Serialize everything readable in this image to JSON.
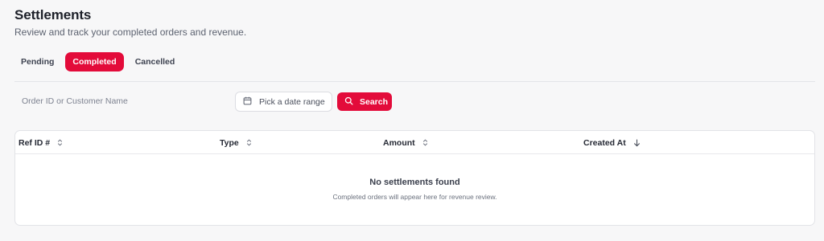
{
  "header": {
    "title": "Settlements",
    "subtitle": "Review and track your completed orders and revenue."
  },
  "tabs": [
    {
      "label": "Pending",
      "active": false
    },
    {
      "label": "Completed",
      "active": true
    },
    {
      "label": "Cancelled",
      "active": false
    }
  ],
  "filters": {
    "search_placeholder": "Order ID or Customer Name",
    "search_value": "",
    "date_range_label": "Pick a date range",
    "date_icon": "calendar-icon",
    "search_button_label": "Search",
    "search_button_icon": "search-icon"
  },
  "table": {
    "columns": [
      {
        "label": "Ref ID #",
        "sort": "unsorted"
      },
      {
        "label": "Type",
        "sort": "unsorted"
      },
      {
        "label": "Amount",
        "sort": "unsorted"
      },
      {
        "label": "Created At",
        "sort": "descending"
      }
    ],
    "rows": [],
    "empty_title": "No settlements found",
    "empty_subtitle": "Completed orders will appear here for revenue review."
  },
  "colors": {
    "accent": "#e30b3a",
    "background": "#f7f7f8",
    "card": "#ffffff",
    "border": "#e2e3e7"
  }
}
